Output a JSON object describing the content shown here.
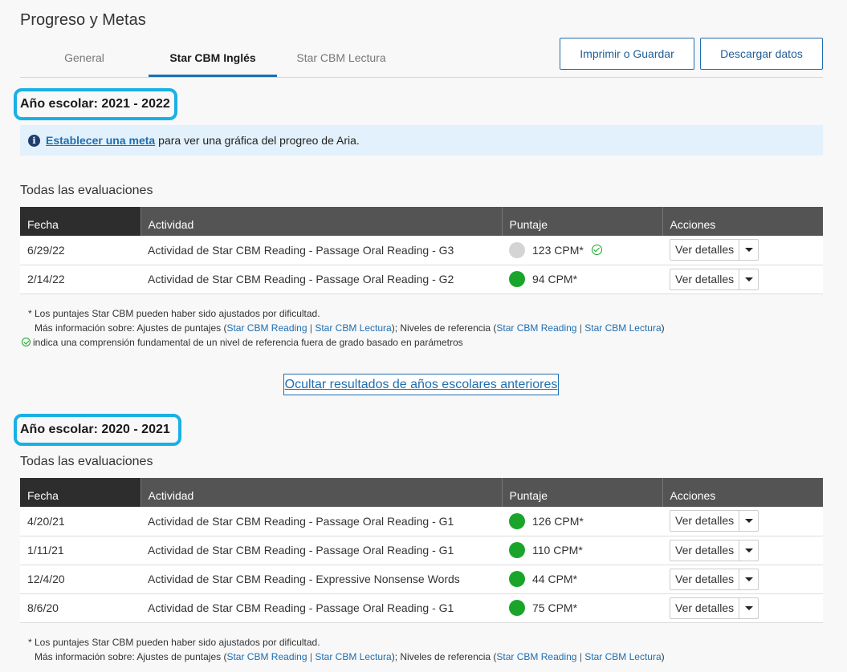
{
  "page_title": "Progreso y Metas",
  "tabs": [
    {
      "label": "General",
      "active": false
    },
    {
      "label": "Star CBM Inglés",
      "active": true
    },
    {
      "label": "Star CBM Lectura",
      "active": false
    }
  ],
  "actions": {
    "print_label": "Imprimir o Guardar",
    "download_label": "Descargar datos"
  },
  "info_banner": {
    "icon": "info-icon",
    "link_text": "Establecer una meta",
    "text": "para ver una gráfica del progreo de Aria."
  },
  "table_headers": {
    "date": "Fecha",
    "activity": "Actividad",
    "score": "Puntaje",
    "actions": "Acciones"
  },
  "action_button_label": "Ver detalles",
  "colors": {
    "accent": "#1f6eb0",
    "highlight_border": "#19b0e6",
    "score_green": "#1aa52a",
    "score_grey": "#d4d4d4",
    "banner_bg": "#e2f1fb"
  },
  "years": [
    {
      "label": "Año escolar: 2021 - 2022",
      "section_label": "Todas las evaluaciones",
      "rows": [
        {
          "date": "6/29/22",
          "activity": "Actividad de Star CBM Reading - Passage Oral Reading - G3",
          "score": "123 CPM*",
          "dot": "grey",
          "check": true
        },
        {
          "date": "2/14/22",
          "activity": "Actividad de Star CBM Reading - Passage Oral Reading - G2",
          "score": "94 CPM*",
          "dot": "green",
          "check": false
        }
      ]
    },
    {
      "label": "Año escolar: 2020 - 2021",
      "section_label": "Todas las evaluaciones",
      "rows": [
        {
          "date": "4/20/21",
          "activity": "Actividad de Star CBM Reading - Passage Oral Reading - G1",
          "score": "126 CPM*",
          "dot": "green",
          "check": false
        },
        {
          "date": "1/11/21",
          "activity": "Actividad de Star CBM Reading - Passage Oral Reading - G1",
          "score": "110 CPM*",
          "dot": "green",
          "check": false
        },
        {
          "date": "12/4/20",
          "activity": "Actividad de Star CBM Reading - Expressive Nonsense Words",
          "score": "44 CPM*",
          "dot": "green",
          "check": false
        },
        {
          "date": "8/6/20",
          "activity": "Actividad de Star CBM Reading - Passage Oral Reading - G1",
          "score": "75 CPM*",
          "dot": "green",
          "check": false
        }
      ]
    }
  ],
  "footnotes": {
    "line1": "* Los puntajes Star CBM pueden haber sido ajustados por dificultad.",
    "line2_prefix": "Más información sobre: Ajustes de puntajes (",
    "link_reading": "Star CBM Reading",
    "separator": "|",
    "link_lectura": "Star CBM Lectura",
    "line2_mid": "); Niveles de referencia (",
    "line2_suffix": ")",
    "line3": "indica una comprensión fundamental de un nivel de referencia fuera de grado basado en parámetros"
  },
  "toggle_prev_label": "Ocultar resultados de años escolares anteriores"
}
